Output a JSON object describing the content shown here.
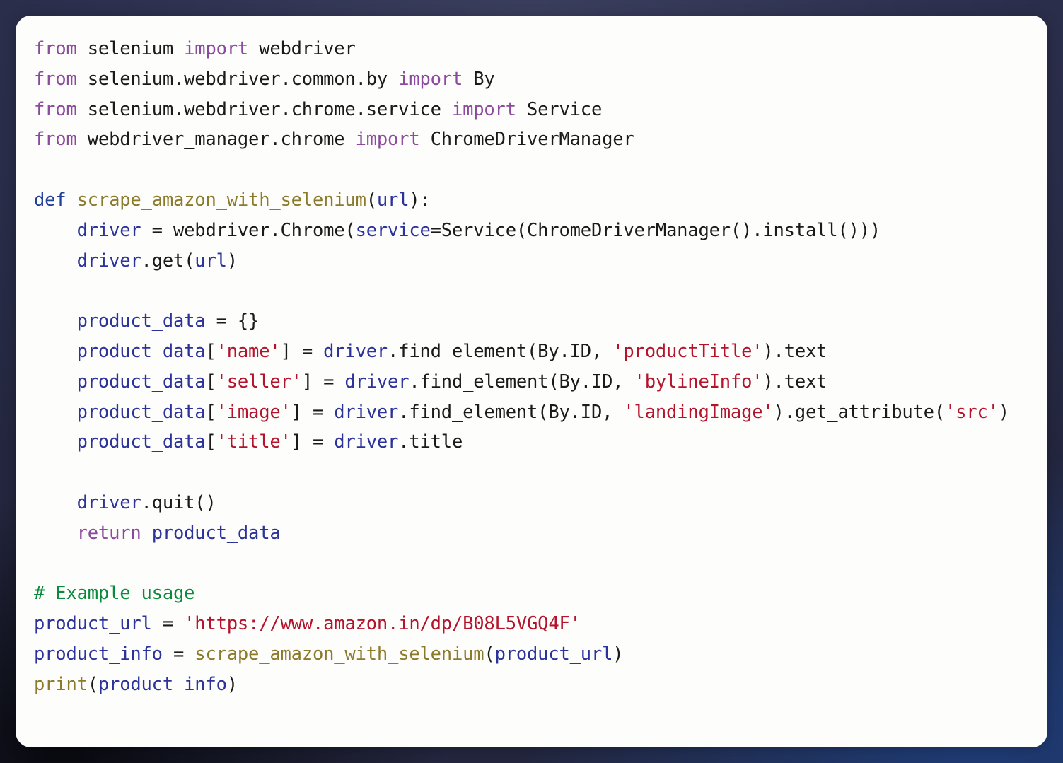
{
  "card": {
    "language": "python",
    "background_color": "#fdfdfb",
    "page_background_color": "#2e3150"
  },
  "theme": {
    "keyword": "#8B4A9E",
    "def_keyword": "#22409A",
    "function_name": "#8C7A2B",
    "variable": "#2B339B",
    "string": "#B5132C",
    "comment": "#0B8A3E",
    "plain": "#1a1a1a",
    "builtin": "#8C7A2B"
  },
  "code": {
    "lines": [
      {
        "id": "line-1",
        "tokens": [
          {
            "t": "from",
            "c": "kw"
          },
          {
            "t": " selenium ",
            "c": "plain"
          },
          {
            "t": "import",
            "c": "kw"
          },
          {
            "t": " webdriver",
            "c": "plain"
          }
        ]
      },
      {
        "id": "line-2",
        "tokens": [
          {
            "t": "from",
            "c": "kw"
          },
          {
            "t": " selenium.webdriver.common.by ",
            "c": "plain"
          },
          {
            "t": "import",
            "c": "kw"
          },
          {
            "t": " By",
            "c": "plain"
          }
        ]
      },
      {
        "id": "line-3",
        "tokens": [
          {
            "t": "from",
            "c": "kw"
          },
          {
            "t": " selenium.webdriver.chrome.service ",
            "c": "plain"
          },
          {
            "t": "import",
            "c": "kw"
          },
          {
            "t": " Service",
            "c": "plain"
          }
        ]
      },
      {
        "id": "line-4",
        "tokens": [
          {
            "t": "from",
            "c": "kw"
          },
          {
            "t": " webdriver_manager.chrome ",
            "c": "plain"
          },
          {
            "t": "import",
            "c": "kw"
          },
          {
            "t": " ChromeDriverManager",
            "c": "plain"
          }
        ]
      },
      {
        "id": "line-5",
        "tokens": []
      },
      {
        "id": "line-6",
        "tokens": [
          {
            "t": "def",
            "c": "def"
          },
          {
            "t": " ",
            "c": "plain"
          },
          {
            "t": "scrape_amazon_with_selenium",
            "c": "fn"
          },
          {
            "t": "(",
            "c": "plain"
          },
          {
            "t": "url",
            "c": "var"
          },
          {
            "t": "):",
            "c": "plain"
          }
        ]
      },
      {
        "id": "line-7",
        "tokens": [
          {
            "t": "    ",
            "c": "plain"
          },
          {
            "t": "driver",
            "c": "var"
          },
          {
            "t": " = webdriver.Chrome(",
            "c": "plain"
          },
          {
            "t": "service",
            "c": "var"
          },
          {
            "t": "=Service(ChromeDriverManager().install()))",
            "c": "plain"
          }
        ]
      },
      {
        "id": "line-8",
        "tokens": [
          {
            "t": "    ",
            "c": "plain"
          },
          {
            "t": "driver",
            "c": "var"
          },
          {
            "t": ".get(",
            "c": "plain"
          },
          {
            "t": "url",
            "c": "var"
          },
          {
            "t": ")",
            "c": "plain"
          }
        ]
      },
      {
        "id": "line-9",
        "tokens": []
      },
      {
        "id": "line-10",
        "tokens": [
          {
            "t": "    ",
            "c": "plain"
          },
          {
            "t": "product_data",
            "c": "var"
          },
          {
            "t": " = {}",
            "c": "plain"
          }
        ]
      },
      {
        "id": "line-11",
        "tokens": [
          {
            "t": "    ",
            "c": "plain"
          },
          {
            "t": "product_data",
            "c": "var"
          },
          {
            "t": "[",
            "c": "plain"
          },
          {
            "t": "'name'",
            "c": "str"
          },
          {
            "t": "] = ",
            "c": "plain"
          },
          {
            "t": "driver",
            "c": "var"
          },
          {
            "t": ".find_element(By.ID, ",
            "c": "plain"
          },
          {
            "t": "'productTitle'",
            "c": "str"
          },
          {
            "t": ").text",
            "c": "plain"
          }
        ]
      },
      {
        "id": "line-12",
        "tokens": [
          {
            "t": "    ",
            "c": "plain"
          },
          {
            "t": "product_data",
            "c": "var"
          },
          {
            "t": "[",
            "c": "plain"
          },
          {
            "t": "'seller'",
            "c": "str"
          },
          {
            "t": "] = ",
            "c": "plain"
          },
          {
            "t": "driver",
            "c": "var"
          },
          {
            "t": ".find_element(By.ID, ",
            "c": "plain"
          },
          {
            "t": "'bylineInfo'",
            "c": "str"
          },
          {
            "t": ").text",
            "c": "plain"
          }
        ]
      },
      {
        "id": "line-13",
        "tokens": [
          {
            "t": "    ",
            "c": "plain"
          },
          {
            "t": "product_data",
            "c": "var"
          },
          {
            "t": "[",
            "c": "plain"
          },
          {
            "t": "'image'",
            "c": "str"
          },
          {
            "t": "] = ",
            "c": "plain"
          },
          {
            "t": "driver",
            "c": "var"
          },
          {
            "t": ".find_element(By.ID, ",
            "c": "plain"
          },
          {
            "t": "'landingImage'",
            "c": "str"
          },
          {
            "t": ").get_attribute(",
            "c": "plain"
          },
          {
            "t": "'src'",
            "c": "str"
          },
          {
            "t": ")",
            "c": "plain"
          }
        ]
      },
      {
        "id": "line-14",
        "tokens": [
          {
            "t": "    ",
            "c": "plain"
          },
          {
            "t": "product_data",
            "c": "var"
          },
          {
            "t": "[",
            "c": "plain"
          },
          {
            "t": "'title'",
            "c": "str"
          },
          {
            "t": "] = ",
            "c": "plain"
          },
          {
            "t": "driver",
            "c": "var"
          },
          {
            "t": ".title",
            "c": "plain"
          }
        ]
      },
      {
        "id": "line-15",
        "tokens": []
      },
      {
        "id": "line-16",
        "tokens": [
          {
            "t": "    ",
            "c": "plain"
          },
          {
            "t": "driver",
            "c": "var"
          },
          {
            "t": ".quit()",
            "c": "plain"
          }
        ]
      },
      {
        "id": "line-17",
        "tokens": [
          {
            "t": "    ",
            "c": "plain"
          },
          {
            "t": "return",
            "c": "kw"
          },
          {
            "t": " ",
            "c": "plain"
          },
          {
            "t": "product_data",
            "c": "var"
          }
        ]
      },
      {
        "id": "line-18",
        "tokens": []
      },
      {
        "id": "line-19",
        "tokens": [
          {
            "t": "# Example usage",
            "c": "com"
          }
        ]
      },
      {
        "id": "line-20",
        "tokens": [
          {
            "t": "product_url",
            "c": "var"
          },
          {
            "t": " = ",
            "c": "plain"
          },
          {
            "t": "'https://www.amazon.in/dp/B08L5VGQ4F'",
            "c": "str"
          }
        ]
      },
      {
        "id": "line-21",
        "tokens": [
          {
            "t": "product_info",
            "c": "var"
          },
          {
            "t": " = ",
            "c": "plain"
          },
          {
            "t": "scrape_amazon_with_selenium",
            "c": "fn"
          },
          {
            "t": "(",
            "c": "plain"
          },
          {
            "t": "product_url",
            "c": "var"
          },
          {
            "t": ")",
            "c": "plain"
          }
        ]
      },
      {
        "id": "line-22",
        "tokens": [
          {
            "t": "print",
            "c": "builtin"
          },
          {
            "t": "(",
            "c": "plain"
          },
          {
            "t": "product_info",
            "c": "var"
          },
          {
            "t": ")",
            "c": "plain"
          }
        ]
      }
    ]
  }
}
